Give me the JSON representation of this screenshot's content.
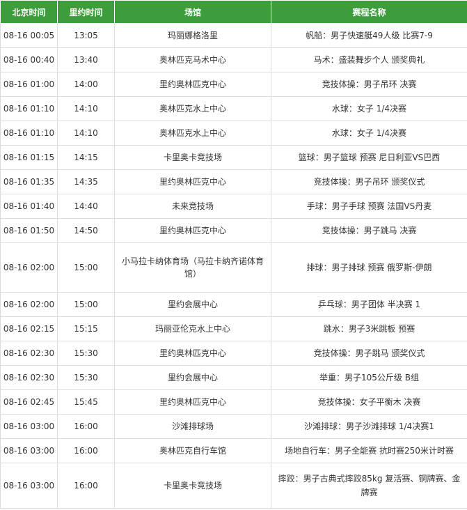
{
  "headers": [
    "北京时间",
    "里约时间",
    "场馆",
    "赛程名称"
  ],
  "rows": [
    {
      "bj": "08-16 00:05",
      "rio": "13:05",
      "venue": "玛丽娜格洛里",
      "event": "帆船：男子快速艇49人级 比赛7-9"
    },
    {
      "bj": "08-16 00:40",
      "rio": "13:40",
      "venue": "奥林匹克马术中心",
      "event": "马术：盛装舞步个人 颁奖典礼"
    },
    {
      "bj": "08-16 01:00",
      "rio": "14:00",
      "venue": "里约奥林匹克中心",
      "event": "竞技体操：男子吊环 决赛"
    },
    {
      "bj": "08-16 01:10",
      "rio": "14:10",
      "venue": "奥林匹克水上中心",
      "event": "水球：女子 1/4决赛"
    },
    {
      "bj": "08-16 01:10",
      "rio": "14:10",
      "venue": "奥林匹克水上中心",
      "event": "水球：女子 1/4决赛"
    },
    {
      "bj": "08-16 01:15",
      "rio": "14:15",
      "venue": "卡里奥卡竞技场",
      "event": "篮球：男子篮球 预赛 尼日利亚VS巴西"
    },
    {
      "bj": "08-16 01:35",
      "rio": "14:35",
      "venue": "里约奥林匹克中心",
      "event": "竞技体操：男子吊环 颁奖仪式"
    },
    {
      "bj": "08-16 01:40",
      "rio": "14:40",
      "venue": "未来竞技场",
      "event": "手球：男子手球 预赛 法国VS丹麦"
    },
    {
      "bj": "08-16 01:50",
      "rio": "14:50",
      "venue": "里约奥林匹克中心",
      "event": "竞技体操：男子跳马 决赛"
    },
    {
      "bj": "08-16 02:00",
      "rio": "15:00",
      "venue": "小马拉卡纳体育场（马拉卡纳齐诺体育馆）",
      "event": "排球：男子排球 预赛 俄罗斯-伊朗"
    },
    {
      "bj": "08-16 02:00",
      "rio": "15:00",
      "venue": "里约会展中心",
      "event": "乒乓球：男子团体 半决赛 1"
    },
    {
      "bj": "08-16 02:15",
      "rio": "15:15",
      "venue": "玛丽亚伦克水上中心",
      "event": "跳水：男子3米跳板 预赛"
    },
    {
      "bj": "08-16 02:30",
      "rio": "15:30",
      "venue": "里约奥林匹克中心",
      "event": "竞技体操：男子跳马 颁奖仪式"
    },
    {
      "bj": "08-16 02:30",
      "rio": "15:30",
      "venue": "里约会展中心",
      "event": "举重：男子105公斤级 B组"
    },
    {
      "bj": "08-16 02:45",
      "rio": "15:45",
      "venue": "里约奥林匹克中心",
      "event": "竞技体操：女子平衡木 决赛"
    },
    {
      "bj": "08-16 03:00",
      "rio": "16:00",
      "venue": "沙滩排球场",
      "event": "沙滩排球：男子沙滩排球 1/4决赛1"
    },
    {
      "bj": "08-16 03:00",
      "rio": "16:00",
      "venue": "奥林匹克自行车馆",
      "event": "场地自行车：男子全能赛 抗时赛250米计时赛"
    },
    {
      "bj": "08-16 03:00",
      "rio": "16:00",
      "venue": "卡里奥卡竞技场",
      "event": "摔跤：男子古典式摔跤85kg 复活赛、铜牌赛、金牌赛"
    }
  ]
}
